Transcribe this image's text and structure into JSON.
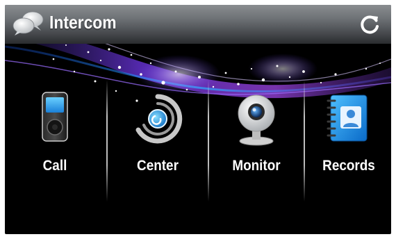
{
  "header": {
    "title": "Intercom",
    "app_icon": "chat-bubbles-icon",
    "refresh_icon": "refresh-icon"
  },
  "menu": {
    "items": [
      {
        "label": "Call",
        "icon": "handset-icon"
      },
      {
        "label": "Center",
        "icon": "center-ring-icon"
      },
      {
        "label": "Monitor",
        "icon": "webcam-icon"
      },
      {
        "label": "Records",
        "icon": "address-book-icon"
      }
    ]
  },
  "colors": {
    "background": "#000000",
    "accent_purple": "#8a3cff",
    "accent_blue": "#2aa6ff"
  }
}
